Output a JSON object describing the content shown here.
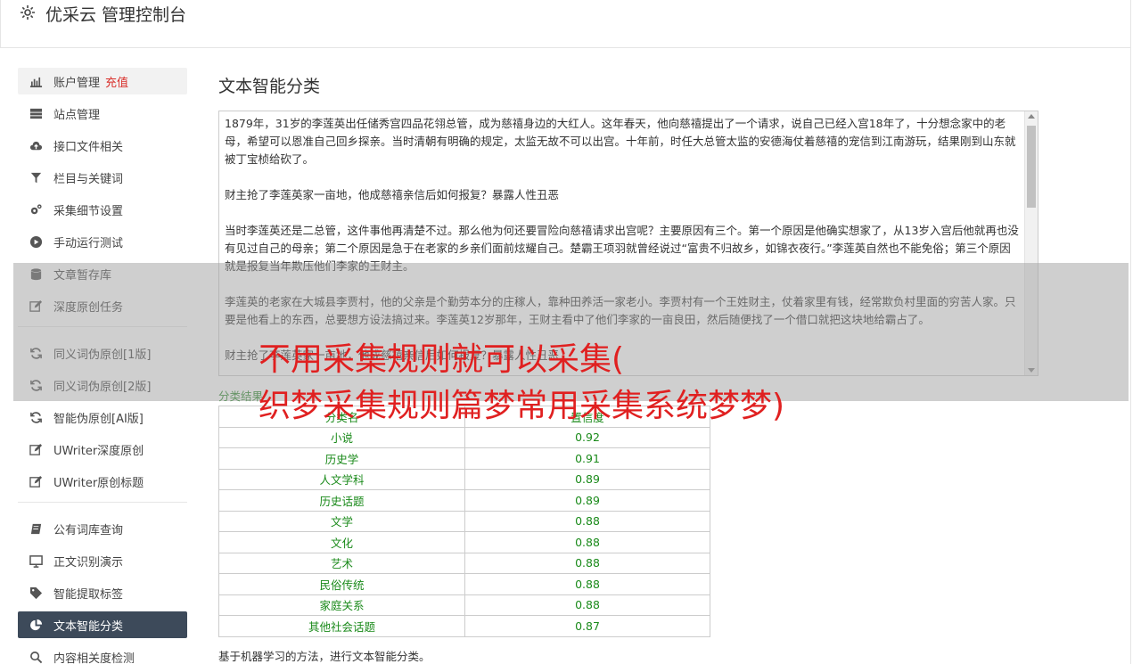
{
  "app": {
    "title": "优采云 管理控制台",
    "icon": "gear-icon"
  },
  "sidebar": {
    "items": [
      {
        "label": "账户管理",
        "badge": "充值",
        "icon": "bar-chart-icon"
      },
      {
        "label": "站点管理",
        "icon": "server-icon"
      },
      {
        "label": "接口文件相关",
        "icon": "cloud-upload-icon"
      },
      {
        "label": "栏目与关键词",
        "icon": "filter-icon"
      },
      {
        "label": "采集细节设置",
        "icon": "cogs-icon"
      },
      {
        "label": "手动运行测试",
        "icon": "play-circle-icon"
      },
      {
        "label": "文章暂存库",
        "icon": "database-icon"
      },
      {
        "label": "深度原创任务",
        "icon": "edit-icon"
      },
      {
        "label": "同义词伪原创[1版]",
        "icon": "refresh-icon"
      },
      {
        "label": "同义词伪原创[2版]",
        "icon": "refresh-icon"
      },
      {
        "label": "智能伪原创[AI版]",
        "icon": "refresh-icon"
      },
      {
        "label": "UWriter深度原创",
        "icon": "edit-icon"
      },
      {
        "label": "UWriter原创标题",
        "icon": "edit-icon"
      },
      {
        "label": "公有词库查询",
        "icon": "book-icon"
      },
      {
        "label": "正文识别演示",
        "icon": "monitor-icon"
      },
      {
        "label": "智能提取标签",
        "icon": "tag-icon"
      },
      {
        "label": "文本智能分类",
        "icon": "pie-chart-icon"
      },
      {
        "label": "内容相关度检测",
        "icon": "search-icon"
      }
    ]
  },
  "main": {
    "title": "文本智能分类",
    "text_paragraphs": [
      "1879年，31岁的李莲英出任储秀宫四品花翎总管，成为慈禧身边的大红人。这年春天，他向慈禧提出了一个请求，说自己已经入宫18年了，十分想念家中的老母，希望可以恩准自己回乡探亲。当时清朝有明确的规定，太监无故不可以出宫。十年前，时任大总管太监的安德海仗着慈禧的宠信到江南游玩，结果刚到山东就被丁宝桢给砍了。",
      "财主抢了李莲英家一亩地，他成慈禧亲信后如何报复？暴露人性丑恶",
      "当时李莲英还是二总管，这件事他再清楚不过。那么他为何还要冒险向慈禧请求出宫呢？主要原因有三个。第一个原因是他确实想家了，从13岁入宫后他就再也没有见过自己的母亲；第二个原因是急于在老家的乡亲们面前炫耀自己。楚霸王项羽就曾经说过“富贵不归故乡，如锦衣夜行。”李莲英自然也不能免俗；第三个原因就是报复当年欺压他们李家的王财主。",
      "李莲英的老家在大城县李贾村，他的父亲是个勤劳本分的庄稼人，靠种田养活一家老小。李贾村有一个王姓财主，仗着家里有钱，经常欺负村里面的穷苦人家。只要是他看上的东西，总要想方设法搞过来。李莲英12岁那年，王财主看中了他们李家的一亩良田，然后随便找了一个借口就把这块地给霸占了。",
      "财主抢了李莲英家一亩地，他成慈禧亲信后如何报复？暴露人性丑恶"
    ],
    "result_label": "分类结果",
    "table_headers": [
      "分类名",
      "置信度"
    ],
    "results": [
      {
        "category": "小说",
        "score": "0.92"
      },
      {
        "category": "历史学",
        "score": "0.91"
      },
      {
        "category": "人文学科",
        "score": "0.89"
      },
      {
        "category": "历史话题",
        "score": "0.89"
      },
      {
        "category": "文学",
        "score": "0.88"
      },
      {
        "category": "文化",
        "score": "0.88"
      },
      {
        "category": "艺术",
        "score": "0.88"
      },
      {
        "category": "民俗传统",
        "score": "0.88"
      },
      {
        "category": "家庭关系",
        "score": "0.88"
      },
      {
        "category": "其他社会话题",
        "score": "0.87"
      }
    ],
    "footnote": "基于机器学习的方法，进行文本智能分类。"
  },
  "overlay": {
    "line1": "不用采集规则就可以采集(",
    "line2": "织梦采集规则篇梦常用采集系统梦梦)"
  },
  "colors": {
    "accent_dark": "#3d4a5a",
    "recharge_red": "#d9302b",
    "result_green": "#1a8a1a",
    "overlay_text": "#e02020"
  }
}
